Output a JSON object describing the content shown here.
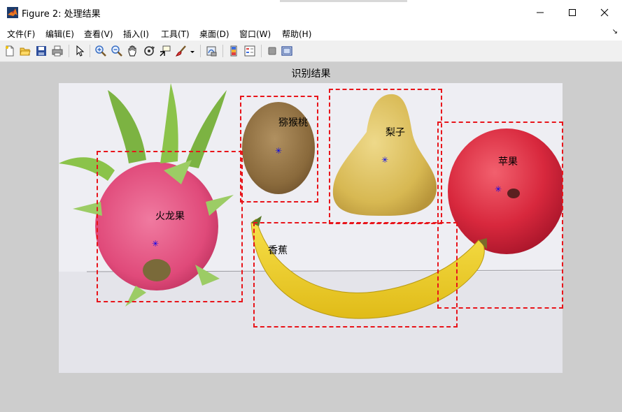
{
  "window": {
    "title": "Figure 2: 处理结果"
  },
  "menu": [
    "文件(F)",
    "编辑(E)",
    "查看(V)",
    "插入(I)",
    "工具(T)",
    "桌面(D)",
    "窗口(W)",
    "帮助(H)"
  ],
  "toolbar": {
    "icons": [
      "new-figure-icon",
      "open-file-icon",
      "save-icon",
      "print-icon",
      "pointer-icon",
      "zoom-in-icon",
      "zoom-out-icon",
      "pan-icon",
      "rotate-3d-icon",
      "data-cursor-icon",
      "brush-icon",
      "link-plot-icon",
      "colorbar-icon",
      "legend-icon",
      "hide-plot-tools-icon",
      "show-plot-tools-icon"
    ]
  },
  "figure": {
    "axes_title": "识别结果",
    "detections": [
      {
        "label": "猕猴桃"
      },
      {
        "label": "梨子"
      },
      {
        "label": "苹果"
      },
      {
        "label": "火龙果"
      },
      {
        "label": "香蕉"
      }
    ],
    "colors": {
      "box": "#e8141a",
      "center_marker": "#0000ee",
      "figure_bg": "#cdcdcd"
    }
  }
}
